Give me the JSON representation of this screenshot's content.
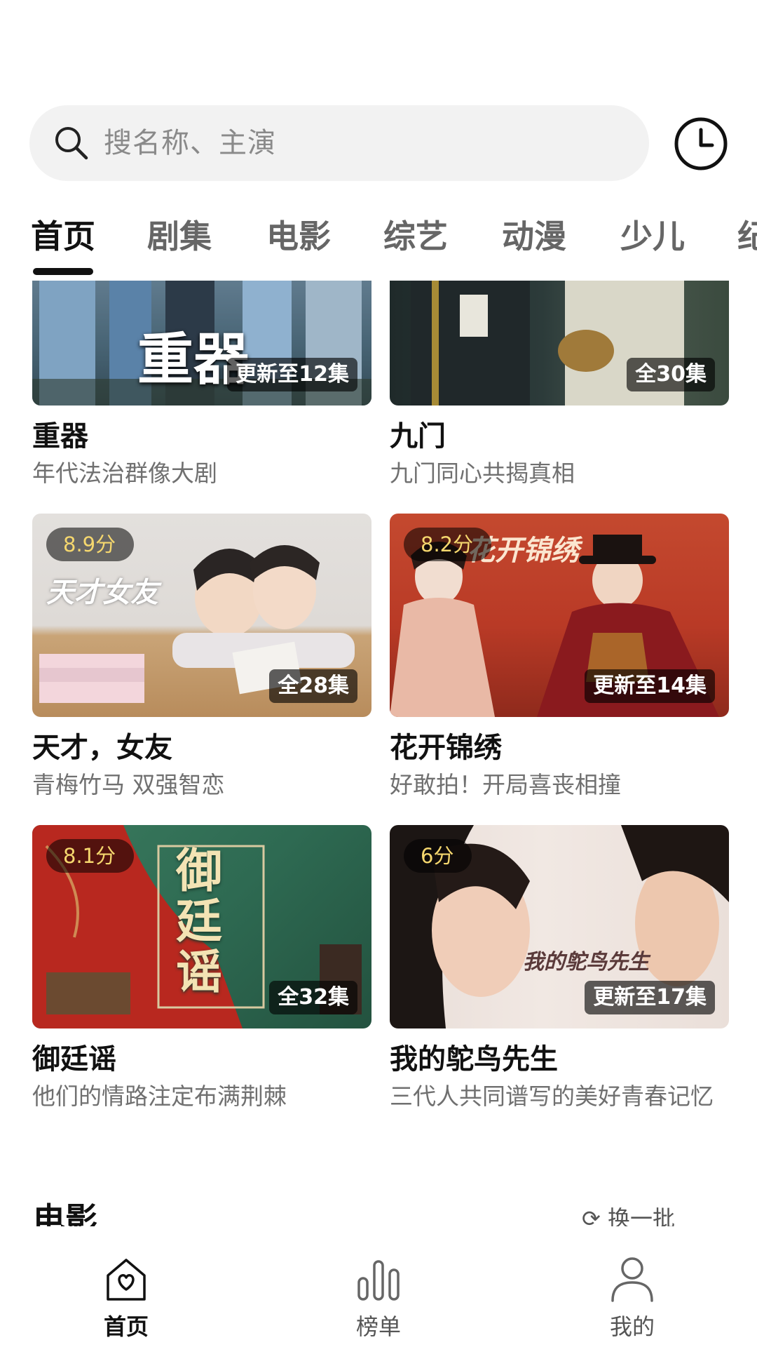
{
  "search": {
    "placeholder": "搜名称、主演"
  },
  "tabs": [
    {
      "label": "首页"
    },
    {
      "label": "剧集"
    },
    {
      "label": "电影"
    },
    {
      "label": "综艺"
    },
    {
      "label": "动漫"
    },
    {
      "label": "少儿"
    },
    {
      "label": "纪"
    }
  ],
  "cards": [
    {
      "title": "重器",
      "subtitle": "年代法治群像大剧",
      "episodes": "更新至12集",
      "poster_text": "重器"
    },
    {
      "title": "九门",
      "subtitle": "九门同心共揭真相",
      "episodes": "全30集"
    },
    {
      "title": "天才，女友",
      "subtitle": "青梅竹马 双强智恋",
      "episodes": "全28集",
      "score": "8.9分",
      "poster_text": "天才女友"
    },
    {
      "title": "花开锦绣",
      "subtitle": "好敢拍！开局喜丧相撞",
      "episodes": "更新至14集",
      "score": "8.2分",
      "poster_text": "花开锦绣"
    },
    {
      "title": "御廷谣",
      "subtitle": "他们的情路注定布满荆棘",
      "episodes": "全32集",
      "score": "8.1分",
      "poster_text": "御廷谣"
    },
    {
      "title": "我的鸵鸟先生",
      "subtitle": "三代人共同谱写的美好青春记忆",
      "episodes": "更新至17集",
      "score": "6分",
      "poster_text": "我的鸵鸟先生"
    }
  ],
  "section": {
    "title": "电影",
    "refresh_label": "换一批"
  },
  "bottom_nav": [
    {
      "label": "首页",
      "icon": "home-heart-icon",
      "active": true
    },
    {
      "label": "榜单",
      "icon": "chart-bars-icon",
      "active": false
    },
    {
      "label": "我的",
      "icon": "user-icon",
      "active": false
    }
  ],
  "colors": {
    "accent_score": "#f5d76e",
    "text_primary": "#111111",
    "text_secondary": "#707070"
  }
}
